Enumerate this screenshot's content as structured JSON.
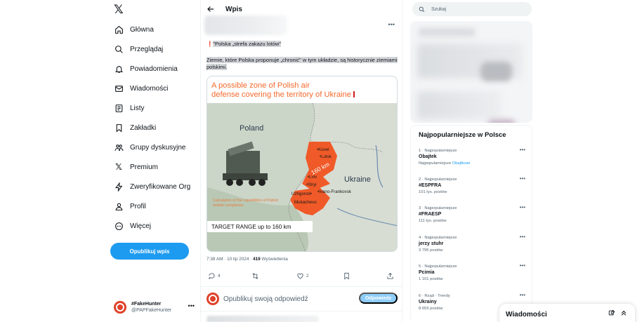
{
  "nav": {
    "items": [
      {
        "label": "Główna",
        "icon": "home-icon"
      },
      {
        "label": "Przeglądaj",
        "icon": "search-icon"
      },
      {
        "label": "Powiadomienia",
        "icon": "bell-icon"
      },
      {
        "label": "Wiadomości",
        "icon": "mail-icon"
      },
      {
        "label": "Listy",
        "icon": "list-icon"
      },
      {
        "label": "Zakładki",
        "icon": "bookmark-icon"
      },
      {
        "label": "Grupy dyskusyjne",
        "icon": "communities-icon"
      },
      {
        "label": "Premium",
        "icon": "x-logo-icon"
      },
      {
        "label": "Zweryfikowane Org",
        "icon": "lightning-icon"
      },
      {
        "label": "Profil",
        "icon": "profile-icon"
      },
      {
        "label": "Więcej",
        "icon": "more-circle-icon"
      }
    ],
    "post_button": "Opublikuj wpis",
    "account": {
      "name": "#FakeHunter",
      "handle": "@PAPFakeHunter"
    }
  },
  "main": {
    "header_title": "Wpis",
    "tweet": {
      "line1": "\"Polska „strefa zakazu lotów\"",
      "line2": "Ziemie, które Polska proponuje „chronić\" w tym układzie, są historycznie ziemiami polskimi.",
      "image": {
        "title_line1": "A possible zone of Polish air",
        "title_line2": "defense covering the territory of Ukraine",
        "poland_label": "Poland",
        "ukraine_label": "Ukraine",
        "cities": [
          "Kovel",
          "Lutsk",
          "Lviv",
          "Stryi",
          "Uzhgorod",
          "Ivano-Frankovsk",
          "Mukachevo"
        ],
        "km_label": "160 km",
        "note": "Calculation of the capabilities of Patriot mobile complexes",
        "range_label": "TARGET RANGE up to 160 km"
      },
      "time": "7:38 AM · 10 lip 2024 · ",
      "views": "419",
      "views_label": " Wyświetlenia",
      "replies": "4",
      "likes": "2"
    },
    "reply": {
      "placeholder": "Opublikuj swoją odpowiedź",
      "button": "Odpowiedz"
    }
  },
  "right": {
    "search_placeholder": "Szukaj",
    "trends_title": "Najpopularniejsze w Polsce",
    "trends": [
      {
        "meta": "1 · Najpopularniejsze",
        "name": "Obajtek",
        "sub_prefix": "Najpopularniejsze ",
        "sub_link": "Obajtkowi"
      },
      {
        "meta": "2 · Najpopularniejsze",
        "name": "#ESPFRA",
        "sub": "101 tys. postów"
      },
      {
        "meta": "3 · Najpopularniejsze",
        "name": "#FRAESP",
        "sub": "111 tys. postów"
      },
      {
        "meta": "4 · Najpopularniejsze",
        "name": "jerzy stuhr",
        "sub": "3 795 postów"
      },
      {
        "meta": "5 · Najpopularniejsze",
        "name": "Pcimia",
        "sub": "1 101 postów"
      },
      {
        "meta": "6 · Rząd · Trendy",
        "name": "Ukrainy",
        "sub": "8 659 postów"
      }
    ]
  },
  "drawer": {
    "title": "Wiadomości"
  },
  "colors": {
    "accent": "#1d9bf0",
    "map_zone": "#f05a28",
    "map_title": "#f36a2d"
  }
}
